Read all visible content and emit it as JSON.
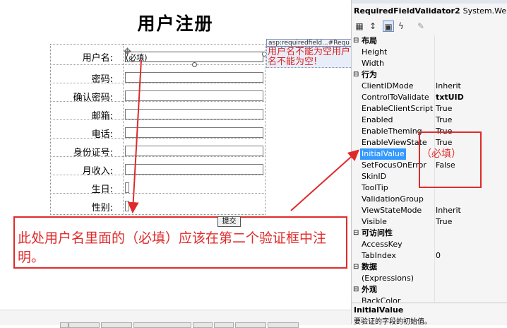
{
  "designer": {
    "page_title": "用户注册",
    "fields": [
      {
        "label": "用户名:"
      },
      {
        "label": "密码:"
      },
      {
        "label": "确认密码:"
      },
      {
        "label": "邮箱:"
      },
      {
        "label": "电话:"
      },
      {
        "label": "身份证号:"
      },
      {
        "label": "月收入:"
      },
      {
        "label": "生日:"
      },
      {
        "label": "性别:"
      }
    ],
    "username_initial_value": "(必填)",
    "validator_tag": "asp:requiredfield...#Requ",
    "validator_message": "用户名不能为空用户名不能为空!",
    "submit_label": "提交",
    "annotation_text": "此处用户名里面的（必填）应该在第二个验证框中注明。"
  },
  "properties": {
    "object_name": "RequiredFieldValidator2",
    "object_type": "System.Web.UI.W",
    "toolbar_icons": [
      "categorized-icon",
      "alphabetical-icon",
      "properties-icon",
      "events-icon",
      "property-pages-icon"
    ],
    "categories": [
      {
        "name": "布局",
        "rows": [
          {
            "name": "Height",
            "value": ""
          },
          {
            "name": "Width",
            "value": ""
          }
        ]
      },
      {
        "name": "行为",
        "rows": [
          {
            "name": "ClientIDMode",
            "value": "Inherit"
          },
          {
            "name": "ControlToValidate",
            "value": "txtUID"
          },
          {
            "name": "EnableClientScript",
            "value": "True"
          },
          {
            "name": "Enabled",
            "value": "True"
          },
          {
            "name": "EnableTheming",
            "value": "True"
          },
          {
            "name": "EnableViewState",
            "value": "True"
          },
          {
            "name": "InitialValue",
            "value": ""
          },
          {
            "name": "SetFocusOnError",
            "value": "False"
          },
          {
            "name": "SkinID",
            "value": ""
          },
          {
            "name": "ToolTip",
            "value": ""
          },
          {
            "name": "ValidationGroup",
            "value": ""
          },
          {
            "name": "ViewStateMode",
            "value": "Inherit"
          },
          {
            "name": "Visible",
            "value": "True"
          }
        ]
      },
      {
        "name": "可访问性",
        "rows": [
          {
            "name": "AccessKey",
            "value": ""
          },
          {
            "name": "TabIndex",
            "value": "0"
          }
        ]
      },
      {
        "name": "数据",
        "rows": [
          {
            "name": "(Expressions)",
            "value": ""
          }
        ]
      },
      {
        "name": "外观",
        "rows": [
          {
            "name": "BackColor",
            "value": ""
          }
        ]
      }
    ],
    "description_title": "InitialValue",
    "description_text": "要验证的字段的初始值。",
    "callout_text": "（必填）"
  },
  "colors": {
    "annotation_red": "#e02a2a",
    "selection_blue": "#3399ff"
  }
}
